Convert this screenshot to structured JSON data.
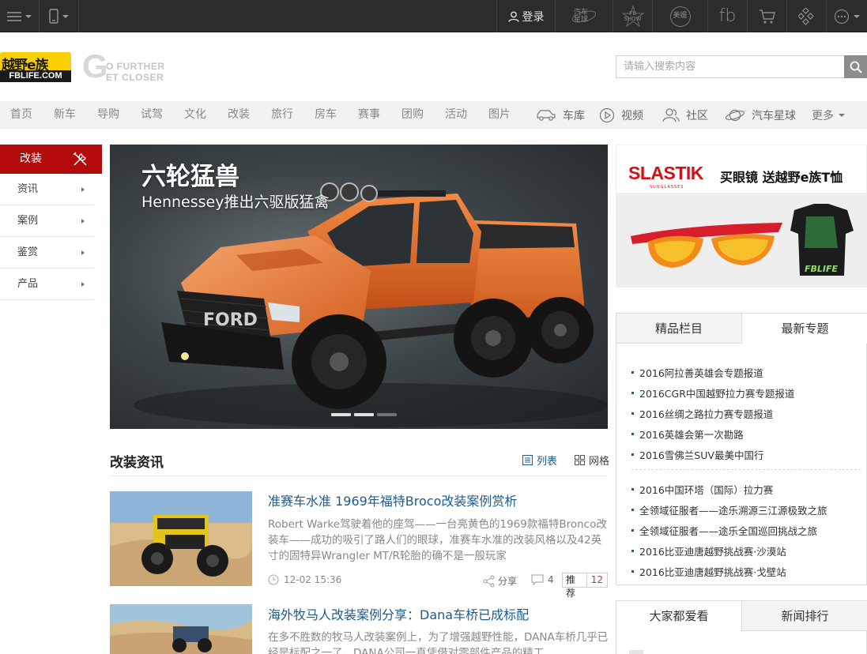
{
  "topbar": {
    "login_label": "登录",
    "star_label_1": "汽车",
    "star_label_2": "星球",
    "show_label_1": "FB",
    "show_label_2": "SHOW",
    "badge_label": "美媛",
    "fb_label": "fb"
  },
  "header": {
    "logo_cn": "越野e族",
    "logo_en": "FBLIFE.COM",
    "slogan_letter": "G",
    "slogan_line1": "O FURTHER",
    "slogan_line2": "ET CLOSER",
    "search_placeholder": "请输入搜索内容"
  },
  "nav": {
    "items": [
      "首页",
      "新车",
      "导购",
      "试驾",
      "文化",
      "改装",
      "旅行",
      "房车",
      "赛事",
      "团购",
      "活动",
      "图片"
    ],
    "icon_items": [
      "车库",
      "视频",
      "社区",
      "汽车星球"
    ],
    "more_label": "更多"
  },
  "sidebar": {
    "title": "改装",
    "items": [
      "资讯",
      "案例",
      "鉴赏",
      "产品"
    ]
  },
  "hero": {
    "title": "六轮猛兽",
    "subtitle": "Hennessey推出六驱版猛禽",
    "logo_text": "FORD"
  },
  "section": {
    "title": "改装资讯",
    "view_list": "列表",
    "view_grid": "网格"
  },
  "articles": [
    {
      "title": "准赛车水准 1969年福特Broco改装案例赏析",
      "summary": "Robert Warke驾驶着他的座驾——一台亮黄色的1969款福特Bronco改装车——成功的吸引了路人们的眼球，准赛车水准的改装风格以及42英寸的固特异Wrangler MT/R轮胎的确不是一般玩家",
      "time": "12-02 15:36",
      "share_label": "分享",
      "comments": "4",
      "recommend_label": "推荐",
      "recommend_count": "12"
    },
    {
      "title": "海外牧马人改装案例分享：Dana车桥已成标配",
      "summary": "在多不胜数的牧马人改装案例上，为了增强越野性能，DANA车桥几乎已经是标配之一了。DANA公司一直凭借对零部件产品的精工"
    }
  ],
  "ad": {
    "brand": "SLASTIK",
    "brand_sub": "SUNGLASSES",
    "slogan": "买眼镜 送越野e族T恤",
    "shirt_text": "FBLIFE"
  },
  "topics": {
    "tabs": [
      "精品栏目",
      "最新专题"
    ],
    "group1": [
      "2016阿拉善英雄会专题报道",
      "2016CGR中国越野拉力赛专题报道",
      "2016丝绸之路拉力赛专题报道",
      "2016英雄会第一次勘路",
      "2016雪佛兰SUV最美中国行"
    ],
    "group2": [
      "2016中国环塔（国际）拉力赛",
      "全领域征服者——途乐溯源三江源极致之旅",
      "全领域征服者——途乐全国巡回挑战之旅",
      "2016比亚迪唐越野挑战赛·沙漠站",
      "2016比亚迪唐越野挑战赛·戈壁站"
    ]
  },
  "rank": {
    "tabs": [
      "大家都爱看",
      "新闻排行"
    ]
  },
  "colors": {
    "topbar": "#2c2c2c",
    "nav_bg": "#f2f2f2",
    "sidebar_accent": "#b30b0b",
    "link_blue": "#1e5a8c",
    "hero_orange": "#e8692a"
  }
}
